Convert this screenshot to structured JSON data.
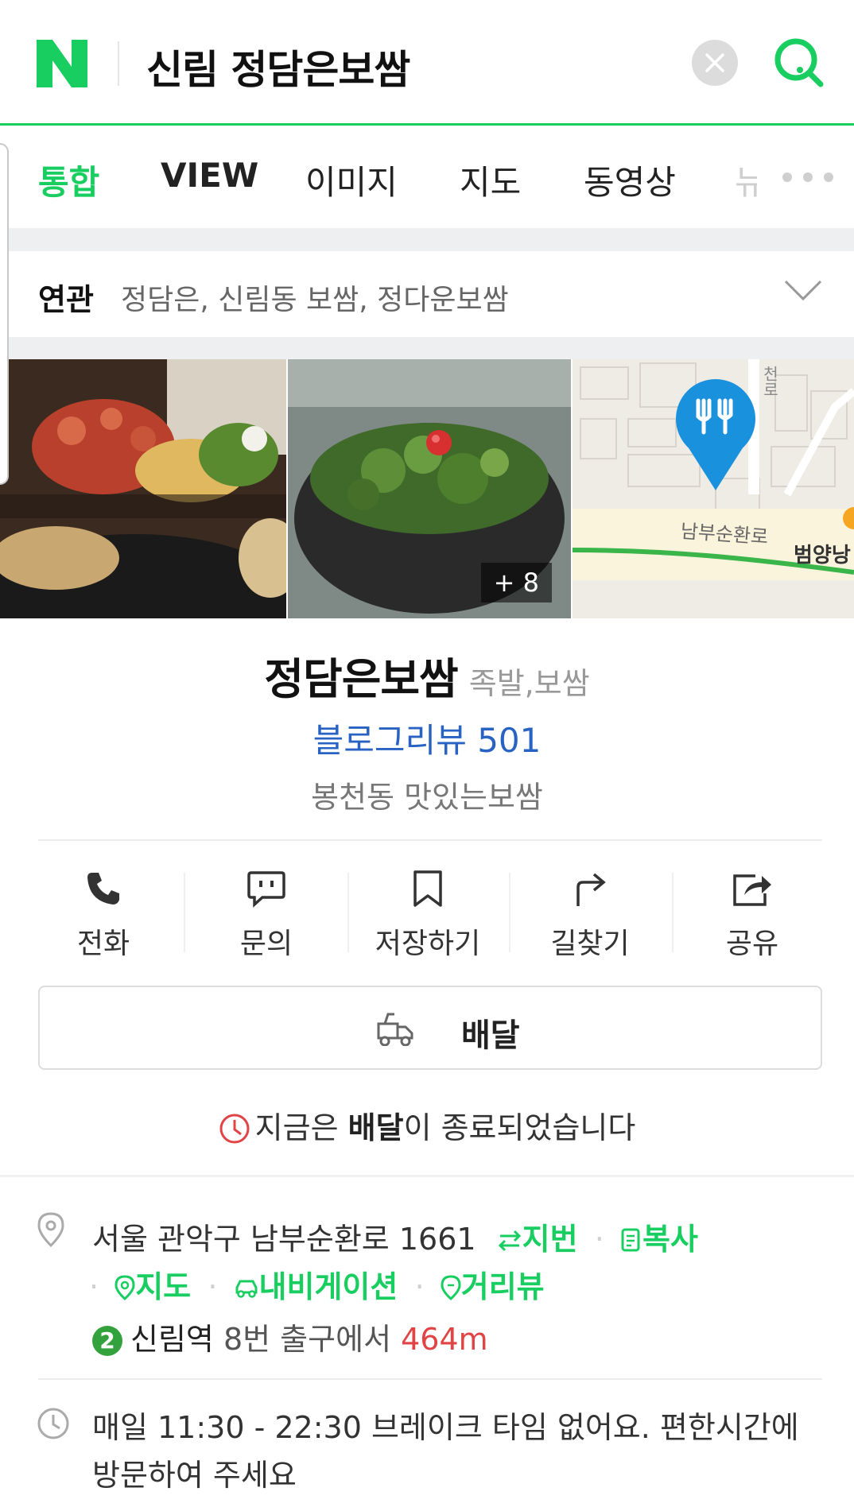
{
  "header": {
    "logo": "N",
    "query": "신림 정담은보쌈",
    "brand_color": "#19ce60"
  },
  "tabs": {
    "items": [
      {
        "label": "통합"
      },
      {
        "label": "VIEW"
      },
      {
        "label": "이미지"
      },
      {
        "label": "지도"
      },
      {
        "label": "동영상"
      },
      {
        "label": "뉴"
      }
    ],
    "active_index": 0
  },
  "related": {
    "label": "연관",
    "terms": "정담은, 신림동 보쌈, 정다운보쌈"
  },
  "photos": {
    "more_count": "+ 8",
    "map_labels": {
      "road": "남부순환로",
      "place": "범양낭",
      "vertical": "천로"
    }
  },
  "place": {
    "name": "정담은보쌈",
    "category": "족발,보쌈",
    "blog_review": "블로그리뷰 501",
    "slogan": "봉천동 맛있는보쌈"
  },
  "actions": [
    {
      "label": "전화",
      "icon": "phone-icon"
    },
    {
      "label": "문의",
      "icon": "chat-icon"
    },
    {
      "label": "저장하기",
      "icon": "bookmark-icon"
    },
    {
      "label": "길찾기",
      "icon": "directions-icon"
    },
    {
      "label": "공유",
      "icon": "share-icon"
    }
  ],
  "delivery": {
    "button_label": "배달",
    "status_prefix": "지금은 ",
    "status_bold": "배달",
    "status_suffix": "이 종료되었습니다",
    "status_icon_color": "#e04444"
  },
  "address": {
    "text": "서울 관악구 남부순환로 1661",
    "lot_number": "지번",
    "copy": "복사",
    "map": "지도",
    "navigation": "내비게이션",
    "street_view": "거리뷰"
  },
  "subway": {
    "line": "2",
    "station": "신림역",
    "exit": " 8번 출구에서 ",
    "distance": "464m"
  },
  "hours": {
    "text": "매일 11:30 - 22:30 브레이크 타임 없어요. 편한시간에 방문하여 주세요"
  }
}
